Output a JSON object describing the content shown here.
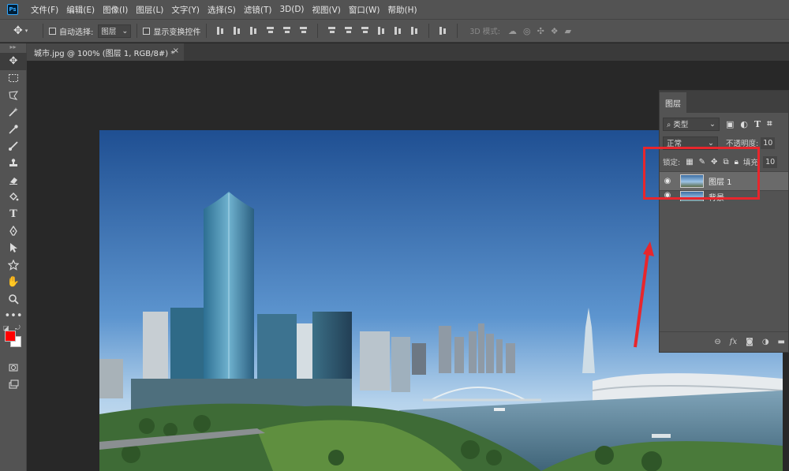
{
  "app": {
    "logo": "Ps"
  },
  "menu": [
    "文件(F)",
    "编辑(E)",
    "图像(I)",
    "图层(L)",
    "文字(Y)",
    "选择(S)",
    "滤镜(T)",
    "3D(D)",
    "视图(V)",
    "窗口(W)",
    "帮助(H)"
  ],
  "options": {
    "auto_select_label": "自动选择:",
    "auto_select_value": "图层",
    "show_transform_label": "显示变换控件",
    "mode_3d_label": "3D 模式:"
  },
  "document": {
    "tab_title": "城市.jpg @ 100% (图层 1, RGB/8#) *",
    "close": "×"
  },
  "toolbar": {
    "tools": [
      "move-tool",
      "marquee-tool",
      "lasso-tool",
      "quick-select-tool",
      "eyedropper-tool",
      "brush-tool",
      "stamp-tool",
      "eraser-tool",
      "paint-bucket-tool",
      "text-tool",
      "pen-tool",
      "path-select-tool",
      "shape-tool",
      "hand-tool",
      "zoom-tool",
      "more-tools"
    ],
    "foreground_color": "#ff0000",
    "background_color": "#ffffff"
  },
  "layers_panel": {
    "tab": "图层",
    "filter_label": "类型",
    "blend_mode": "正常",
    "opacity_label": "不透明度:",
    "opacity_value": "10",
    "lock_label": "锁定:",
    "fill_label": "填充:",
    "fill_value": "10",
    "layers": [
      {
        "name": "图层 1",
        "selected": true
      },
      {
        "name": "背景",
        "selected": false
      }
    ]
  },
  "annotation_color": "#e8262c"
}
